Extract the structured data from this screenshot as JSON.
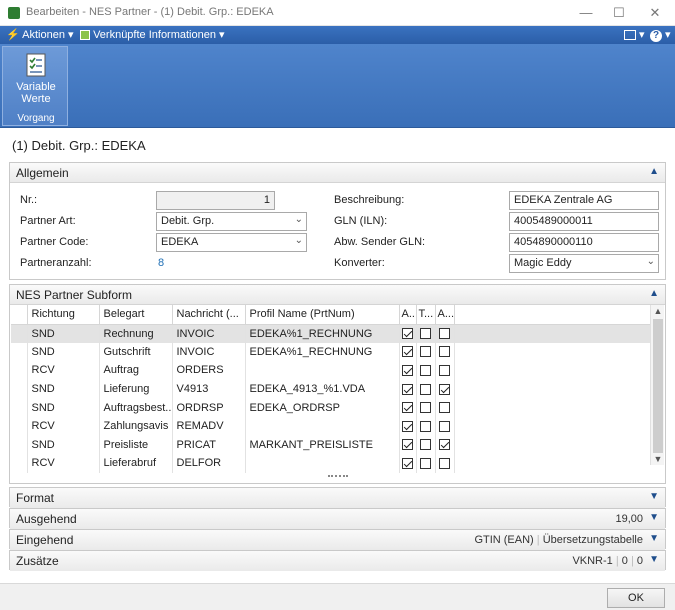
{
  "window": {
    "title": "Bearbeiten - NES Partner - (1) Debit. Grp.: EDEKA"
  },
  "menubar": {
    "actions": "Aktionen",
    "related": "Verknüpfte Informationen"
  },
  "ribbon": {
    "button_label_1": "Variable",
    "button_label_2": "Werte",
    "group_label": "Vorgang"
  },
  "page": {
    "title": "(1) Debit. Grp.: EDEKA"
  },
  "general": {
    "header": "Allgemein",
    "nr_label": "Nr.:",
    "nr_value": "1",
    "partner_art_label": "Partner Art:",
    "partner_art_value": "Debit. Grp.",
    "partner_code_label": "Partner Code:",
    "partner_code_value": "EDEKA",
    "partneranzahl_label": "Partneranzahl:",
    "partneranzahl_value": "8",
    "beschreibung_label": "Beschreibung:",
    "beschreibung_value": "EDEKA Zentrale AG",
    "gln_label": "GLN (ILN):",
    "gln_value": "4005489000011",
    "abw_gln_label": "Abw. Sender GLN:",
    "abw_gln_value": "4054890000110",
    "konverter_label": "Konverter:",
    "konverter_value": "Magic Eddy"
  },
  "subform": {
    "header": "NES Partner Subform",
    "columns": [
      "Richtung",
      "Belegart",
      "Nachricht (...",
      "Profil Name (PrtNum)",
      "A...",
      "T...",
      "A..."
    ],
    "rows": [
      {
        "richtung": "SND",
        "belegart": "Rechnung",
        "nachricht": "INVOIC",
        "profil": "EDEKA%1_RECHNUNG",
        "a": true,
        "t": false,
        "a2": false
      },
      {
        "richtung": "SND",
        "belegart": "Gutschrift",
        "nachricht": "INVOIC",
        "profil": "EDEKA%1_RECHNUNG",
        "a": true,
        "t": false,
        "a2": false
      },
      {
        "richtung": "RCV",
        "belegart": "Auftrag",
        "nachricht": "ORDERS",
        "profil": "",
        "a": true,
        "t": false,
        "a2": false
      },
      {
        "richtung": "SND",
        "belegart": "Lieferung",
        "nachricht": "V4913",
        "profil": "EDEKA_4913_%1.VDA",
        "a": true,
        "t": false,
        "a2": true
      },
      {
        "richtung": "SND",
        "belegart": "Auftragsbest...",
        "nachricht": "ORDRSP",
        "profil": "EDEKA_ORDRSP",
        "a": true,
        "t": false,
        "a2": false
      },
      {
        "richtung": "RCV",
        "belegart": "Zahlungsavis",
        "nachricht": "REMADV",
        "profil": "",
        "a": true,
        "t": false,
        "a2": false
      },
      {
        "richtung": "SND",
        "belegart": "Preisliste",
        "nachricht": "PRICAT",
        "profil": "MARKANT_PREISLISTE",
        "a": true,
        "t": false,
        "a2": true
      },
      {
        "richtung": "RCV",
        "belegart": "Lieferabruf",
        "nachricht": "DELFOR",
        "profil": "",
        "a": true,
        "t": false,
        "a2": false
      }
    ]
  },
  "format": {
    "header": "Format"
  },
  "ausgehend": {
    "header": "Ausgehend",
    "value": "19,00"
  },
  "eingehend": {
    "header": "Eingehend",
    "value1": "GTIN (EAN)",
    "value2": "Übersetzungstabelle"
  },
  "zusaetze": {
    "header": "Zusätze",
    "value1": "VKNR-1",
    "value2": "0",
    "value3": "0"
  },
  "footer": {
    "ok": "OK"
  }
}
